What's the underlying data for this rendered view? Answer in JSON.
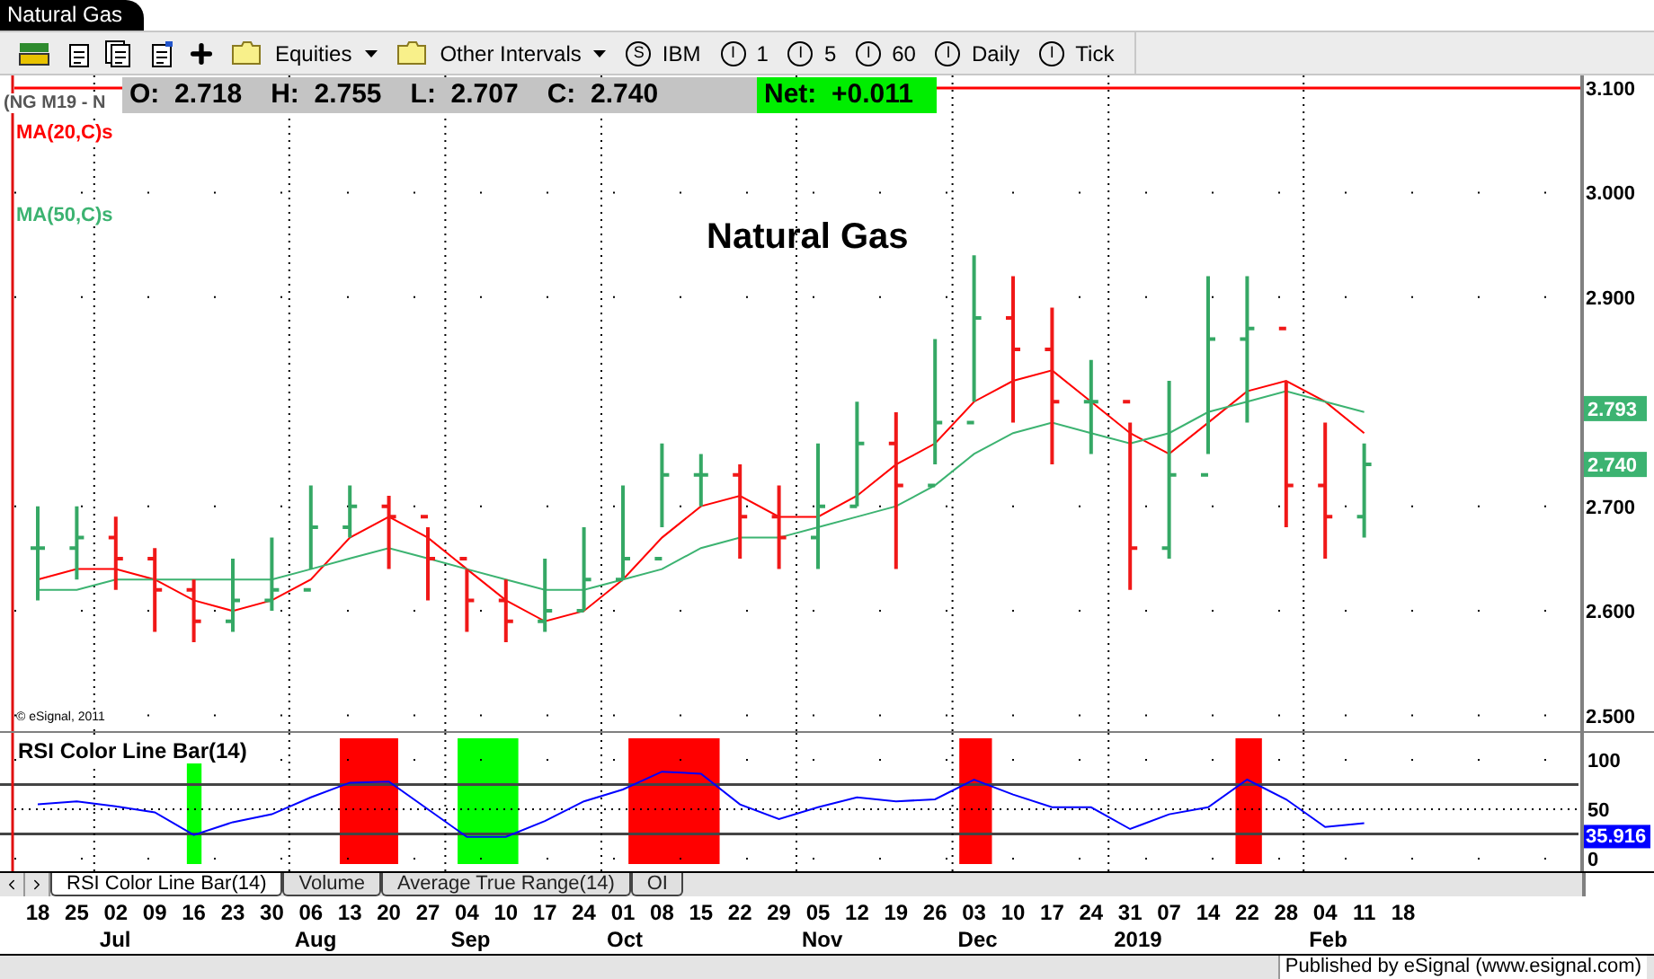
{
  "window": {
    "title": "Natural Gas"
  },
  "toolbar": [
    {
      "kind": "icon"
    },
    {
      "kind": "icon"
    },
    {
      "kind": "icon"
    },
    {
      "kind": "icon"
    },
    {
      "kind": "icon"
    },
    {
      "kind": "folder",
      "label": "Equities"
    },
    {
      "kind": "folder",
      "label": "Other Intervals"
    },
    {
      "kind": "symbol",
      "badge": "S",
      "label": "IBM"
    },
    {
      "kind": "symbol",
      "badge": "I",
      "label": "1"
    },
    {
      "kind": "symbol",
      "badge": "I",
      "label": "5"
    },
    {
      "kind": "symbol",
      "badge": "I",
      "label": "60"
    },
    {
      "kind": "symbol",
      "badge": "I",
      "label": "Daily"
    },
    {
      "kind": "symbol",
      "badge": "I",
      "label": "Tick"
    }
  ],
  "legend": {
    "symbol": "(NG M19 - N",
    "quote": [
      {
        "label": "O:",
        "value": "2.718"
      },
      {
        "label": "H:",
        "value": "2.755"
      },
      {
        "label": "L:",
        "value": "2.707"
      },
      {
        "label": "C:",
        "value": "2.740"
      }
    ],
    "net": {
      "label": "Net:",
      "value": "+0.011"
    },
    "copyright": "© eSignal, 2011"
  },
  "price_chart": {
    "chart_data": {
      "type": "line",
      "title": "Natural Gas",
      "series": [
        {
          "name": "MA(20,C)s",
          "color": "#ff0000",
          "values": [
            2.63,
            2.64,
            2.64,
            2.63,
            2.61,
            2.6,
            2.61,
            2.63,
            2.67,
            2.69,
            2.67,
            2.64,
            2.61,
            2.59,
            2.6,
            2.63,
            2.67,
            2.7,
            2.71,
            2.69,
            2.69,
            2.71,
            2.74,
            2.76,
            2.8,
            2.82,
            2.83,
            2.8,
            2.77,
            2.75,
            2.78,
            2.81,
            2.82,
            2.8,
            2.77,
            null
          ]
        },
        {
          "name": "MA(50,C)s",
          "color": "#3cb371",
          "values": [
            2.62,
            2.62,
            2.63,
            2.63,
            2.63,
            2.63,
            2.63,
            2.64,
            2.65,
            2.66,
            2.65,
            2.64,
            2.63,
            2.62,
            2.62,
            2.63,
            2.64,
            2.66,
            2.67,
            2.67,
            2.68,
            2.69,
            2.7,
            2.72,
            2.75,
            2.77,
            2.78,
            2.77,
            2.76,
            2.77,
            2.79,
            2.8,
            2.81,
            2.8,
            2.79,
            null
          ]
        }
      ],
      "ylim": [
        2.485,
        3.112
      ],
      "yticks": [
        {
          "value": 2.5,
          "label": "2.500"
        },
        {
          "value": 2.6,
          "label": "2.600"
        },
        {
          "value": 2.7,
          "label": "2.700"
        },
        {
          "value": 2.9,
          "label": "2.900"
        },
        {
          "value": 3.0,
          "label": "3.000"
        },
        {
          "value": 3.1,
          "label": "3.100"
        }
      ],
      "grid": true
    },
    "last_values": [
      {
        "text": "2.793",
        "color": "#3cb371"
      },
      {
        "text": "2.740",
        "color": "#3cb371"
      }
    ]
  },
  "rsi_chart": {
    "chart_data": {
      "type": "line",
      "title": "RSI Color Line Bar(14)",
      "categories": [
        "18",
        "25",
        "02",
        "09",
        "16",
        "23",
        "30",
        "06",
        "13",
        "20",
        "27",
        "04",
        "10",
        "17",
        "24",
        "01",
        "08",
        "15",
        "22",
        "29",
        "05",
        "12",
        "19",
        "26",
        "03",
        "10",
        "17",
        "24",
        "31",
        "07",
        "14",
        "22",
        "28",
        "04",
        "11",
        "18"
      ],
      "series": [
        {
          "color": "#0000ff",
          "values": [
            55,
            58,
            53,
            47,
            24,
            37,
            45,
            62,
            77,
            78,
            50,
            22,
            22,
            38,
            58,
            70,
            88,
            86,
            55,
            40,
            52,
            62,
            58,
            60,
            80,
            65,
            52,
            52,
            30,
            45,
            52,
            80,
            60,
            32,
            36,
            null
          ]
        }
      ],
      "ylim": [
        -12.7,
        127.3
      ],
      "yticks": [
        {
          "value": 0,
          "label": "0"
        },
        {
          "value": 50,
          "label": "50"
        },
        {
          "value": 100,
          "label": "100"
        }
      ],
      "grid": true
    },
    "last_value": {
      "text": "35.916",
      "color": "#0000ff"
    }
  },
  "pane_tabs": [
    {
      "label": "RSI Color Line Bar(14)",
      "selected": true
    },
    {
      "label": "Volume",
      "selected": false
    },
    {
      "label": "Average True Range(14)",
      "selected": false
    },
    {
      "label": "OI",
      "selected": false
    }
  ],
  "months": [
    {
      "label": "Jul"
    },
    {
      "label": "Aug"
    },
    {
      "label": "Sep"
    },
    {
      "label": "Oct"
    },
    {
      "label": "Nov"
    },
    {
      "label": "Dec"
    },
    {
      "label": "2019"
    },
    {
      "label": "Feb"
    }
  ],
  "status_bar": "Published by eSignal (www.esignal.com)"
}
